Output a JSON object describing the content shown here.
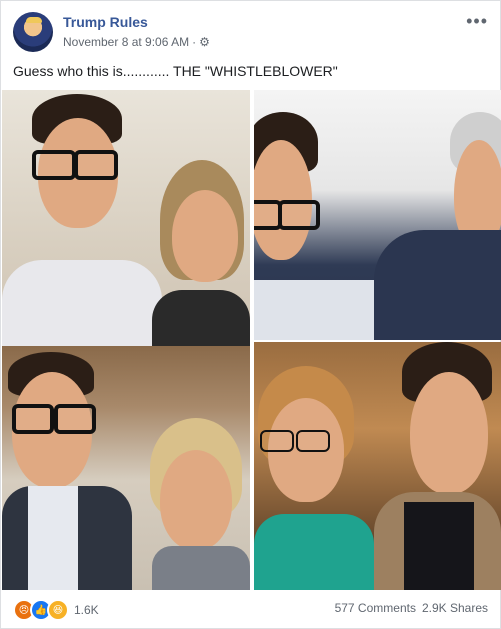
{
  "post": {
    "page_name": "Trump Rules",
    "timestamp": "November 8 at 9:06 AM",
    "separator": "·",
    "text": "Guess who this is............ THE \"WHISTLEBLOWER\""
  },
  "icons": {
    "more": "more-options-icon",
    "privacy": "gear-icon"
  },
  "footer": {
    "reaction_count": "1.6K",
    "comments": "577 Comments",
    "shares": "2.9K Shares"
  },
  "colors": {
    "page_name": "#385898",
    "meta": "#606770",
    "like": "#1877f2",
    "angry": "#e9710f",
    "haha": "#f7b125"
  }
}
